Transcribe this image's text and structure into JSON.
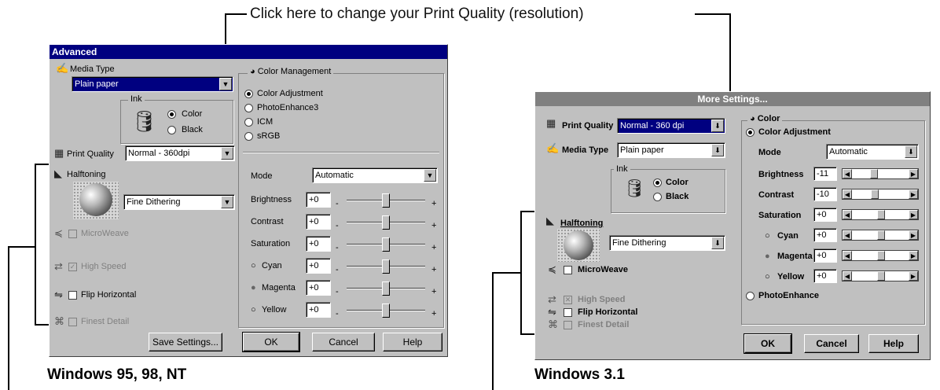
{
  "callout": "Click here to change your Print Quality (resolution)",
  "captions": {
    "win95": "Windows 95, 98, NT",
    "win31": "Windows 3.1"
  },
  "win95": {
    "title": "Advanced",
    "media_type_label": "Media Type",
    "media_type_value": "Plain paper",
    "ink_label": "Ink",
    "ink_color": "Color",
    "ink_black": "Black",
    "print_quality_label": "Print Quality",
    "print_quality_value": "Normal - 360dpi",
    "halftoning_label": "Halftoning",
    "halftoning_value": "Fine Dithering",
    "microweave": "MicroWeave",
    "high_speed": "High Speed",
    "flip_horizontal": "Flip Horizontal",
    "finest_detail": "Finest Detail",
    "save_settings": "Save Settings...",
    "color_mgmt_label": "Color Management",
    "color_adjustment": "Color Adjustment",
    "photoenhance": "PhotoEnhance3",
    "icm": "ICM",
    "srgb": "sRGB",
    "mode_label": "Mode",
    "mode_value": "Automatic",
    "sliders": [
      {
        "label": "Brightness",
        "value": "+0"
      },
      {
        "label": "Contrast",
        "value": "+0"
      },
      {
        "label": "Saturation",
        "value": "+0"
      },
      {
        "label": "Cyan",
        "value": "+0"
      },
      {
        "label": "Magenta",
        "value": "+0"
      },
      {
        "label": "Yellow",
        "value": "+0"
      }
    ],
    "minus": "-",
    "plus": "+",
    "ok": "OK",
    "cancel": "Cancel",
    "help": "Help"
  },
  "win31": {
    "title": "More Settings...",
    "print_quality_label": "Print Quality",
    "print_quality_value": "Normal - 360 dpi",
    "media_type_label": "Media Type",
    "media_type_value": "Plain paper",
    "ink_label": "Ink",
    "ink_color": "Color",
    "ink_black": "Black",
    "halftoning_label": "Halftoning",
    "halftoning_value": "Fine Dithering",
    "microweave": "MicroWeave",
    "high_speed": "High Speed",
    "flip_horizontal": "Flip Horizontal",
    "finest_detail": "Finest Detail",
    "color_label": "Color",
    "color_adjustment": "Color Adjustment",
    "mode_label": "Mode",
    "mode_value": "Automatic",
    "sliders": [
      {
        "label": "Brightness",
        "value": "-11"
      },
      {
        "label": "Contrast",
        "value": "-10"
      },
      {
        "label": "Saturation",
        "value": "+0"
      },
      {
        "label": "Cyan",
        "value": "+0"
      },
      {
        "label": "Magenta",
        "value": "+0"
      },
      {
        "label": "Yellow",
        "value": "+0"
      }
    ],
    "photoenhance": "PhotoEnhance",
    "ok": "OK",
    "cancel": "Cancel",
    "help": "Help"
  }
}
